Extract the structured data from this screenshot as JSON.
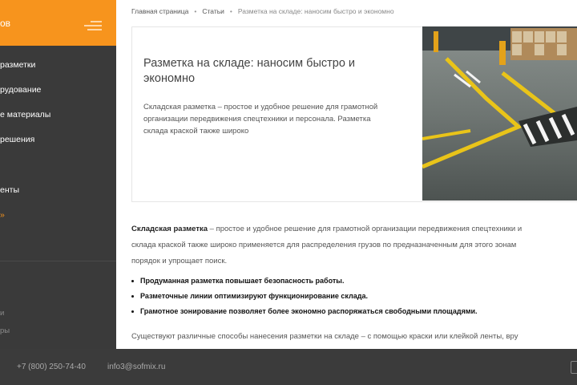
{
  "sidebar": {
    "header_text": "ов",
    "items": [
      {
        "label": "разметки"
      },
      {
        "label": "рудование"
      },
      {
        "label": "е материалы"
      },
      {
        "label": "решения"
      },
      {
        "label": "енты"
      },
      {
        "label": "»"
      },
      {
        "label": "и"
      },
      {
        "label": "ры"
      }
    ]
  },
  "breadcrumb": {
    "home": "Главная страница",
    "sep": "•",
    "articles": "Статьи",
    "current": "Разметка на складе: наносим быстро и экономно"
  },
  "card": {
    "title": "Разметка на складе: наносим быстро и экономно",
    "text": "Складская разметка – простое и удобное решение для грамотной организации передвижения спецтехники и персонала. Разметка склада краской также широко"
  },
  "article": {
    "intro_bold": "Складская разметка",
    "intro_rest": " – простое и удобное решение для грамотной организации передвижения спецтехники и",
    "line2": "склада краской также широко применяется для распределения грузов по предназначенным для этого зонам",
    "line3": "порядок и упрощает поиск.",
    "bullets": [
      "Продуманная разметка повышает безопасность работы.",
      "Разметочные линии оптимизируют функционирование склада.",
      "Грамотное зонирование позволяет более экономно распоряжаться свободными площадями."
    ],
    "para2": "Существуют различные способы нанесения разметки на складе – с помощью краски или клейкой ленты, вру"
  },
  "footer": {
    "phone": "+7 (800) 250-74-40",
    "email": "info3@sofmix.ru"
  },
  "colors": {
    "accent": "#f7941d",
    "sidebar": "#3a3a3a",
    "footer": "#3b3b3b"
  }
}
